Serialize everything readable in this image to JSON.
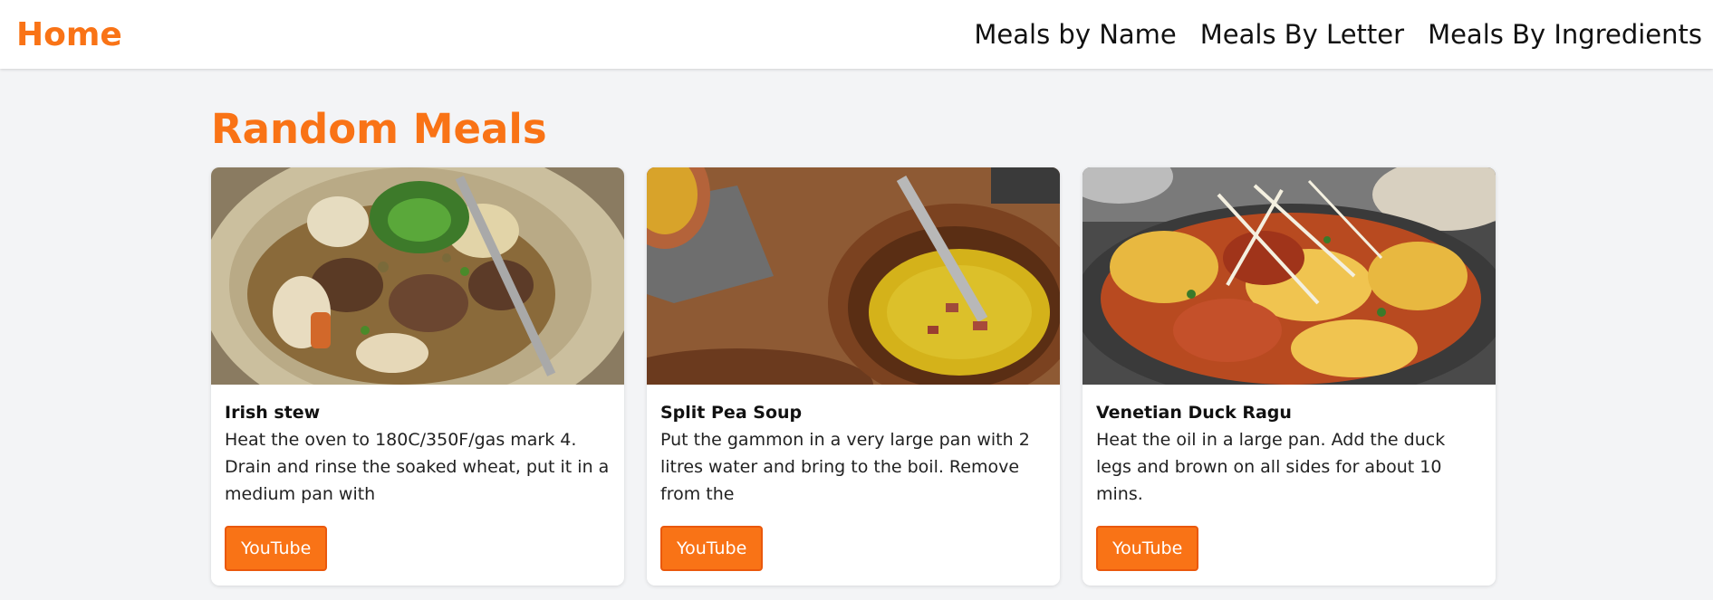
{
  "header": {
    "home_label": "Home",
    "nav": [
      {
        "label": "Meals by Name"
      },
      {
        "label": "Meals By Letter"
      },
      {
        "label": "Meals By Ingredients"
      }
    ]
  },
  "main": {
    "title": "Random Meals",
    "meals": [
      {
        "title": "Irish stew",
        "description": "Heat the oven to 180C/350F/gas mark 4. Drain and rinse the soaked wheat, put it in a medium pan with",
        "button_label": "YouTube"
      },
      {
        "title": "Split Pea Soup",
        "description": "Put the gammon in a very large pan with 2 litres water and bring to the boil. Remove from the",
        "button_label": "YouTube"
      },
      {
        "title": "Venetian Duck Ragu",
        "description": "Heat the oil in a large pan. Add the duck legs and brown on all sides for about 10 mins.",
        "button_label": "YouTube"
      }
    ]
  },
  "colors": {
    "accent": "#f97316",
    "background": "#f3f4f6"
  }
}
